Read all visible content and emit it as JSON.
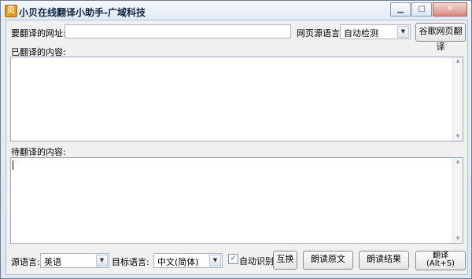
{
  "window": {
    "app_icon_text": "贝",
    "title": "小贝在线翻译小助手-广域科技",
    "controls": {
      "minimize": "▁",
      "maximize": "□",
      "close": "✕"
    }
  },
  "url_row": {
    "url_label": "要翻译的网址:",
    "url_value": "",
    "source_lang_label": "网页源语言:",
    "source_lang_value": "自动检测",
    "google_translate_button": "谷歌网页翻译"
  },
  "translated": {
    "label": "已翻译的内容:",
    "content": ""
  },
  "to_translate": {
    "label": "待翻译的内容:",
    "content": ""
  },
  "bottom": {
    "source_label": "源语言:",
    "source_value": "英语",
    "target_label": "目标语言:",
    "target_value": "中文(简体)",
    "auto_detect_label": "自动识别",
    "auto_detect_checked": true,
    "swap_button": "互换",
    "read_source_button": "朗读原文",
    "read_result_button": "朗读结果",
    "translate_button": "翻译",
    "translate_shortcut": "(Alt+S)"
  },
  "icons": {
    "dropdown_arrow": "▼",
    "scroll_up": "▲",
    "scroll_down": "▼",
    "check_mark": "✓"
  }
}
